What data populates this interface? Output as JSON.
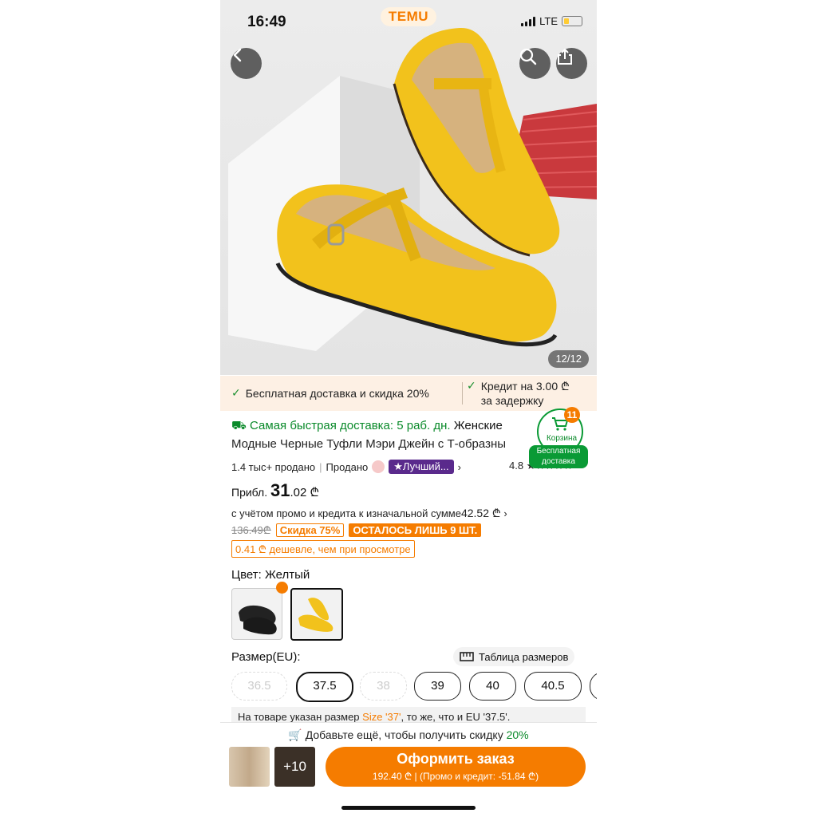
{
  "status": {
    "time": "16:49",
    "brand": "TEMU",
    "network": "LTE"
  },
  "gallery": {
    "counter": "12/12"
  },
  "promo": {
    "free_shipping": "Бесплатная доставка и скидка 20%",
    "credit_line1": "Кредит на 3.00 ₾",
    "credit_line2": "за задержку"
  },
  "product": {
    "fast_delivery": "Самая быстрая доставка: 5 раб. дн.",
    "title_start": " Женские",
    "title_line2": "Модные Черные Туфли Мэри Джейн с Т-образны",
    "sold": "1.4 тыс+ продано",
    "sold_label": "Продано",
    "best_badge": "Лучший...",
    "rating": "4.8 ★★★★★"
  },
  "cart": {
    "count": "11",
    "label": "Корзина",
    "shipping": "Бесплатная доставка"
  },
  "price": {
    "prefix": "Прибл.",
    "whole": "31",
    "cents": ".02 ₾",
    "promo_text": "с учётом промо и кредита к изначальной сумме",
    "promo_amount": "42.52 ₾",
    "original": "136.49₾",
    "discount": "Скидка 75%",
    "stock": "ОСТАЛОСЬ ЛИШЬ 9 ШТ.",
    "cheaper": "0.41 ₾ дешевле, чем при просмотре"
  },
  "color": {
    "label": "Цвет: Желтый"
  },
  "size": {
    "label": "Размер(EU):",
    "chart": "Таблица размеров",
    "options": [
      "36.5",
      "37.5",
      "38",
      "39",
      "40",
      "40.5"
    ],
    "note_a": "На товаре указан размер ",
    "note_b": "Size '37'",
    "note_c": ", то же, что и EU '37.5'."
  },
  "bottom": {
    "add_more": "Добавьте ещё, чтобы получить скидку ",
    "add_more_pct": "20%",
    "more_count": "+10",
    "order_label": "Оформить заказ",
    "order_sub": "192.40 ₾ | (Промо и кредит: -51.84 ₾)"
  },
  "colors": {
    "accent": "#f57c00",
    "green": "#0a8a2a",
    "shoe": "#f2c21c"
  }
}
